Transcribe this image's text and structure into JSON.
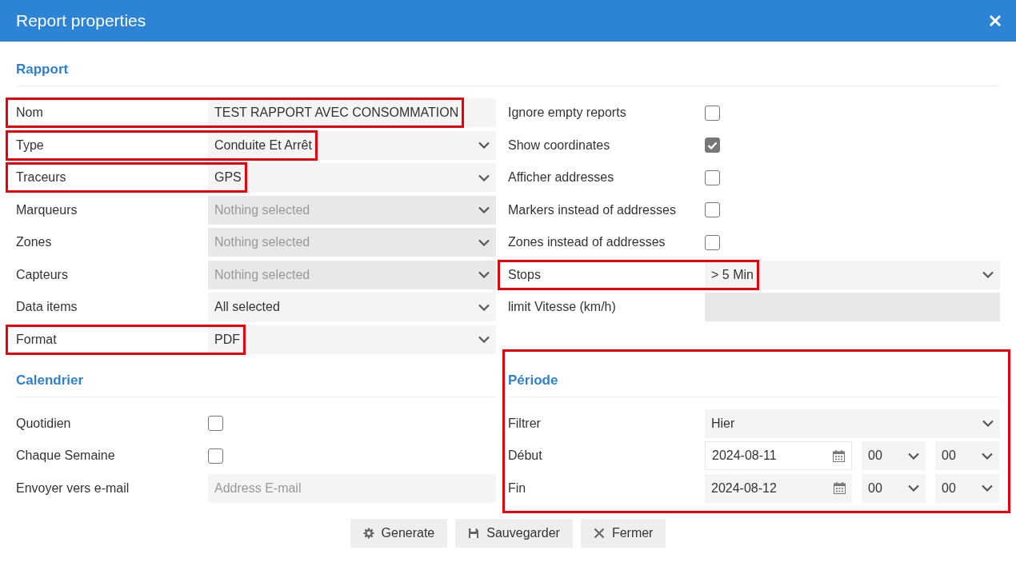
{
  "window": {
    "title": "Report properties"
  },
  "rapport": {
    "heading": "Rapport",
    "left_rows": [
      {
        "label": "Nom",
        "kind": "text",
        "value": "TEST RAPPORT AVEC CONSOMMATION",
        "highlighted": true
      },
      {
        "label": "Type",
        "kind": "select",
        "value": "Conduite Et Arrêt",
        "disabled": false,
        "highlighted": true
      },
      {
        "label": "Traceurs",
        "kind": "select",
        "value": "GPS",
        "disabled": false,
        "highlighted": true
      },
      {
        "label": "Marqueurs",
        "kind": "select",
        "placeholder": "Nothing selected",
        "disabled": true,
        "highlighted": false
      },
      {
        "label": "Zones",
        "kind": "select",
        "placeholder": "Nothing selected",
        "disabled": true,
        "highlighted": false
      },
      {
        "label": "Capteurs",
        "kind": "select",
        "placeholder": "Nothing selected",
        "disabled": true,
        "highlighted": false
      },
      {
        "label": "Data items",
        "kind": "select",
        "value": "All selected",
        "disabled": false,
        "highlighted": false
      },
      {
        "label": "Format",
        "kind": "select",
        "value": "PDF",
        "disabled": false,
        "highlighted": true
      }
    ],
    "right_rows": [
      {
        "label": "Ignore empty reports",
        "kind": "checkbox",
        "checked": false,
        "highlighted": false
      },
      {
        "label": "Show coordinates",
        "kind": "checkbox",
        "checked": true,
        "highlighted": false
      },
      {
        "label": "Afficher addresses",
        "kind": "checkbox",
        "checked": false,
        "highlighted": false
      },
      {
        "label": "Markers instead of addresses",
        "kind": "checkbox",
        "checked": false,
        "highlighted": false
      },
      {
        "label": "Zones instead of addresses",
        "kind": "checkbox",
        "checked": false,
        "highlighted": false
      },
      {
        "label": "Stops",
        "kind": "select",
        "value": "> 5 Min",
        "disabled": false,
        "highlighted": true
      },
      {
        "label": "limit Vitesse (km/h)",
        "kind": "input",
        "disabled": true,
        "highlighted": false
      }
    ]
  },
  "calendrier": {
    "heading": "Calendrier",
    "rows": [
      {
        "label": "Quotidien",
        "kind": "checkbox",
        "checked": false,
        "highlighted": false
      },
      {
        "label": "Chaque Semaine",
        "kind": "checkbox",
        "checked": false,
        "highlighted": false
      },
      {
        "label": "Envoyer vers e-mail",
        "kind": "input",
        "placeholder": "Address E-mail",
        "disabled": false,
        "highlighted": false
      }
    ]
  },
  "periode": {
    "heading": "Période",
    "highlighted": true,
    "filter": {
      "label": "Filtrer",
      "value": "Hier"
    },
    "ranges": [
      {
        "label": "Début",
        "date": "2024-08-11",
        "focused": true,
        "hour": "00",
        "minute": "00"
      },
      {
        "label": "Fin",
        "date": "2024-08-12",
        "focused": false,
        "hour": "00",
        "minute": "00"
      }
    ]
  },
  "buttons": [
    {
      "label": "Generate"
    },
    {
      "label": "Sauvegarder"
    },
    {
      "label": "Fermer"
    }
  ]
}
